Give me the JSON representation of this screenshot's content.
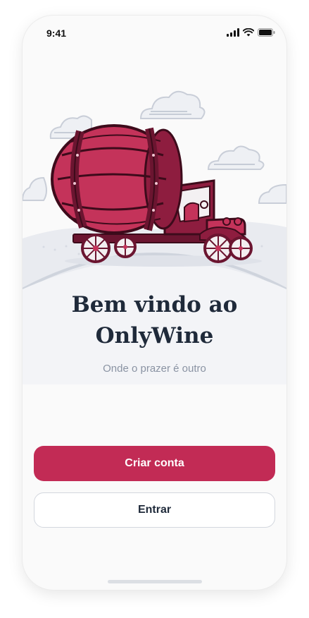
{
  "status_bar": {
    "time": "9:41"
  },
  "welcome": {
    "title_line1": "Bem vindo ao",
    "title_line2": "OnlyWine",
    "subtitle": "Onde o prazer é outro"
  },
  "actions": {
    "create_account_label": "Criar conta",
    "login_label": "Entrar"
  },
  "colors": {
    "accent": "#c22b55",
    "title": "#1f2a3a",
    "subtitle": "#8a93a3",
    "barrel": "#c4335a",
    "barrel_dark": "#6b1530"
  },
  "icons": [
    "signal-icon",
    "wifi-icon",
    "battery-icon"
  ]
}
